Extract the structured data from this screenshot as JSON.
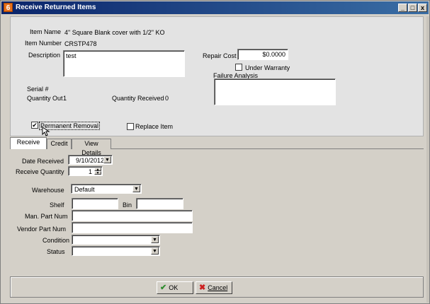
{
  "window": {
    "title": "Receive Returned Items",
    "app_icon": "6",
    "controls": [
      "_",
      "□",
      "x"
    ]
  },
  "item": {
    "name_label": "Item Name",
    "name_value": "4\" Square Blank cover with 1/2\" KO",
    "number_label": "Item Number",
    "number_value": "CRSTP478",
    "description_label": "Description",
    "description_value": "test",
    "repair_cost_label": "Repair Cost",
    "repair_cost_value": "$0.0000",
    "under_warranty_label": "Under Warranty",
    "failure_analysis_label": "Failure Analysis",
    "failure_analysis_value": "",
    "serial_label": "Serial #",
    "quantity_out_label": "Quantity Out",
    "quantity_out_value": "1",
    "quantity_received_label": "Quantity Received",
    "quantity_received_value": "0",
    "permanent_removal_label": "Permanent Removal",
    "permanent_removal_checked": "✔",
    "replace_item_label": "Replace Item"
  },
  "tabs": [
    "Receive",
    "Credit",
    "View Details"
  ],
  "receive": {
    "date_received_label": "Date Received",
    "date_received_value": "9/10/2012",
    "receive_quantity_label": "Receive Quantity",
    "receive_quantity_value": "1",
    "warehouse_label": "Warehouse",
    "warehouse_value": "Default",
    "shelf_label": "Shelf",
    "shelf_value": "",
    "bin_label": "Bin",
    "bin_value": "",
    "man_part_label": "Man. Part Num",
    "man_part_value": "",
    "vendor_part_label": "Vendor Part Num",
    "vendor_part_value": "",
    "condition_label": "Condition",
    "condition_value": "",
    "status_label": "Status",
    "status_value": ""
  },
  "buttons": {
    "ok_label": "OK",
    "cancel_label": "Cancel"
  },
  "icons": {
    "ok": "check-icon",
    "cancel": "x-icon",
    "ok_color": "#2e8b2e",
    "cancel_color": "#cc2020"
  }
}
